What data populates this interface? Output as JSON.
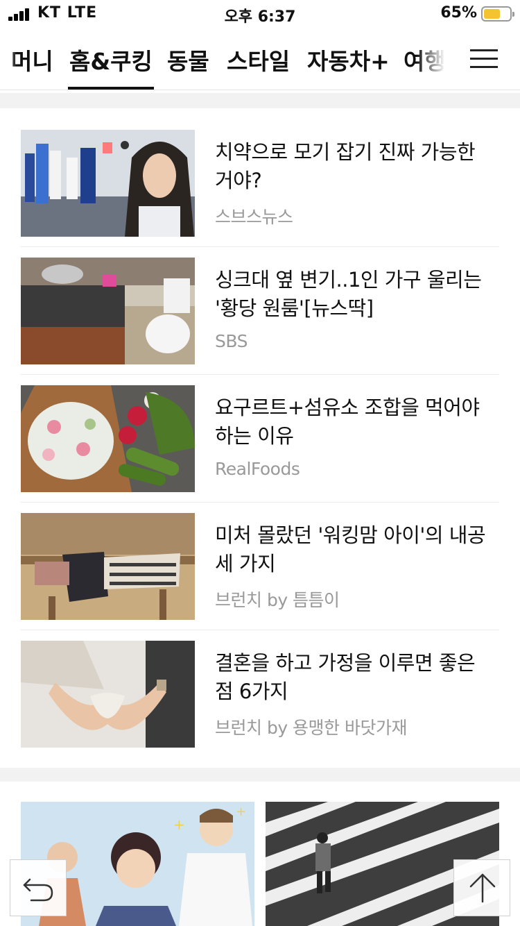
{
  "status_bar": {
    "carrier": "KT LTE",
    "time": "오후 6:37",
    "battery_percent": "65%",
    "battery_level": 0.65,
    "battery_color": "#f4c430"
  },
  "category_nav": {
    "tabs": [
      {
        "label": "머니",
        "active": false
      },
      {
        "label": "홈&쿠킹",
        "active": true
      },
      {
        "label": "동물",
        "active": false
      },
      {
        "label": "스타일",
        "active": false
      },
      {
        "label": "자동차+",
        "active": false
      },
      {
        "label": "여행",
        "active": false
      }
    ],
    "menu_icon": "hamburger-menu-icon"
  },
  "news": [
    {
      "title": "치약으로 모기 잡기 진짜 가능한 거야?",
      "source": "스브스뉴스"
    },
    {
      "title": "싱크대 옆 변기..1인 가구 울리는 '황당 원룸'[뉴스딱]",
      "source": "SBS"
    },
    {
      "title": "요구르트+섬유소 조합을 먹어야 하는 이유",
      "source": "RealFoods"
    },
    {
      "title": "미처 몰랐던 '워킹맘 아이'의 내공 세 가지",
      "source": "브런치 by 틈틈이"
    },
    {
      "title": "결혼을 하고 가정을 이루면 좋은 점 6가지",
      "source": "브런치 by 용맹한 바닷가재"
    }
  ],
  "floating": {
    "back_icon": "undo-arrow-icon",
    "top_icon": "arrow-up-icon"
  },
  "colors": {
    "text": "#111111",
    "source_text": "#999999",
    "divider": "#ececec",
    "section_gap": "#f2f2f2"
  }
}
